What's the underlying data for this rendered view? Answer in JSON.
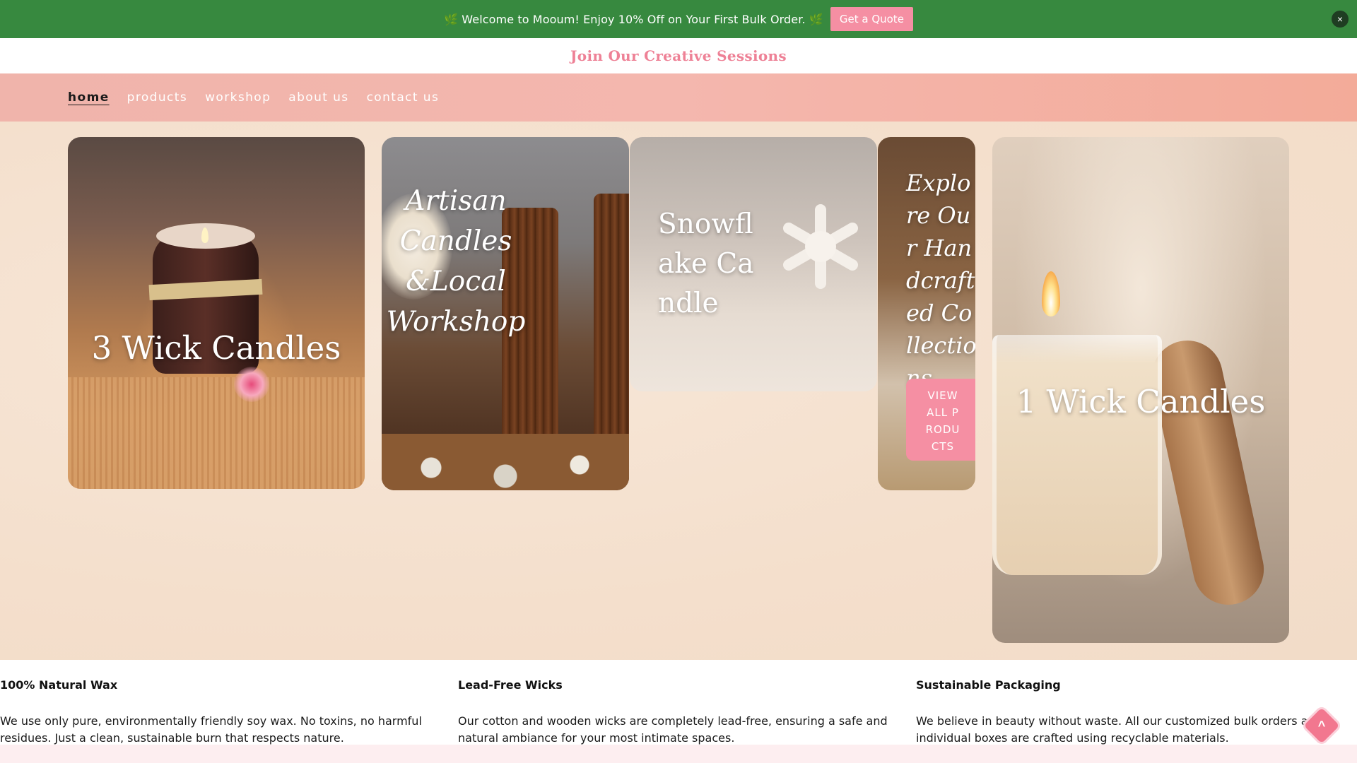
{
  "announcement": {
    "text": "🌿 Welcome to Mooum! Enjoy 10% Off on Your First Bulk Order. 🌿",
    "cta_label": "Get a Quote",
    "close_icon": "×"
  },
  "subbanner": {
    "link_text": "Join Our Creative Sessions"
  },
  "nav": {
    "items": [
      {
        "label": "home",
        "active": true
      },
      {
        "label": "products"
      },
      {
        "label": "workshop"
      },
      {
        "label": "about us"
      },
      {
        "label": "contact us"
      }
    ]
  },
  "hero": {
    "cards": [
      {
        "title": "3 Wick Candles"
      },
      {
        "title": "Artisan Candles &Local Workshop"
      },
      {
        "title": "Snowflake Candle"
      },
      {
        "title": "Explore Our Handcrafted Collections",
        "button_label": "VIEW ALL PRODUCTS"
      },
      {
        "title": "1 Wick Candles"
      }
    ]
  },
  "features": [
    {
      "title": "100% Natural Wax",
      "text": "We use only pure, environmentally friendly soy wax. No toxins, no harmful residues. Just a clean, sustainable burn that respects nature."
    },
    {
      "title": "Lead-Free Wicks",
      "text": "Our cotton and wooden wicks are completely lead-free, ensuring a safe and natural ambiance for your most intimate spaces."
    },
    {
      "title": "Sustainable Packaging",
      "text": "We believe in beauty without waste. All our customized bulk orders and individual boxes are crafted using recyclable materials."
    }
  ],
  "colors": {
    "announcement_bg": "#37893f",
    "accent_pink": "#f58fa3",
    "nav_bg": "#f4b7ae",
    "hero_bg": "#f6e3d3"
  },
  "icons": {
    "close": "close-icon",
    "scroll_top": "arrow-up-icon"
  }
}
